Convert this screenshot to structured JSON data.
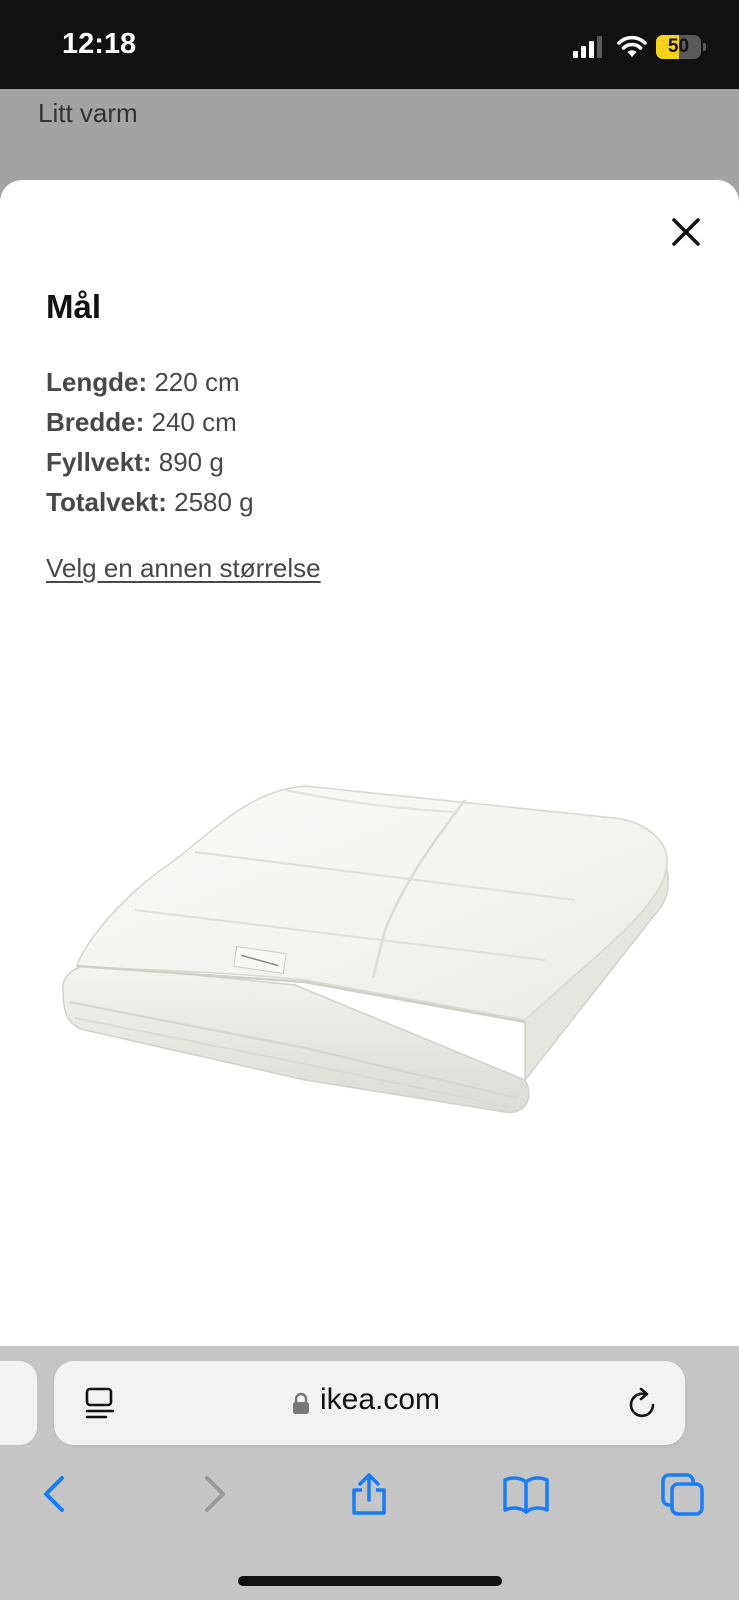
{
  "status_bar": {
    "time": "12:18",
    "battery_level": "50",
    "battery_fraction": 0.5,
    "signal_bars_active": 3,
    "signal_bars_total": 4
  },
  "background_page": {
    "visible_text": "Litt varm"
  },
  "modal": {
    "title": "Mål",
    "close_icon": "close-icon",
    "specs": [
      {
        "label": "Lengde:",
        "value": "220 cm"
      },
      {
        "label": "Bredde:",
        "value": "240 cm"
      },
      {
        "label": "Fyllvekt:",
        "value": "890 g"
      },
      {
        "label": "Totalvekt:",
        "value": "2580 g"
      }
    ],
    "size_link": "Velg en annen størrelse",
    "image": "folded-white-duvet"
  },
  "browser": {
    "url": "ikea.com",
    "icons": [
      "reader-icon",
      "lock-icon",
      "reload-icon",
      "back-icon",
      "forward-icon",
      "share-icon",
      "bookmarks-icon",
      "tabs-icon"
    ],
    "accent_color": "#1a7cf5",
    "disabled_color": "#9a9a9a"
  },
  "colors": {
    "status_bar_bg": "#111111",
    "overlay_bg": "#a3a3a3",
    "sheet_bg": "#ffffff",
    "battery_fill": "#f6d21d"
  }
}
